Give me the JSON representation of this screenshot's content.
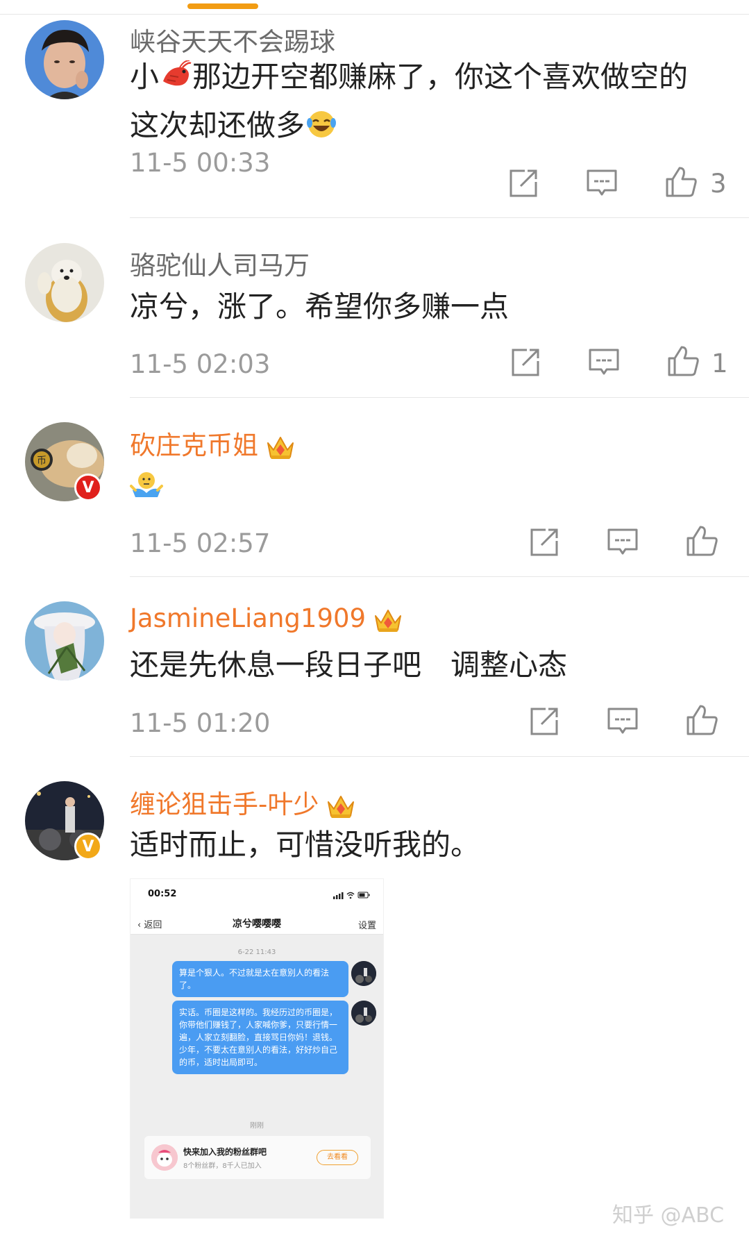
{
  "colors": {
    "accent": "#f29c13",
    "vip_name": "#f0782b",
    "name": "#6b6b6b",
    "meta": "#9b9b9b",
    "bubble": "#4a9cf2"
  },
  "comments": [
    {
      "username": "峡谷天天不会踢球",
      "text_before_emoji": "小",
      "text_after_emoji": "那边开空都赚麻了，你这个喜欢做空的这次却还做多",
      "emojis": [
        "shrimp-emoji",
        "laugh-cry-emoji"
      ],
      "time": "11-5 00:33",
      "likes": "3"
    },
    {
      "username": "骆驼仙人司马万",
      "text": "凉兮，涨了。希望你多赚一点",
      "time": "11-5 02:03",
      "likes": "1"
    },
    {
      "username": "砍庄克币姐",
      "emojis": [
        "shrug-emoji"
      ],
      "time": "11-5 02:57",
      "likes": ""
    },
    {
      "username": "JasmineLiang1909",
      "text": "还是先休息一段日子吧　调整心态",
      "time": "11-5 01:20",
      "likes": ""
    },
    {
      "username": "缠论狙击手-叶少",
      "text": "适时而止，可惜没听我的。"
    }
  ],
  "screenshot": {
    "status_time": "00:52",
    "back": "返回",
    "title": "凉兮嘤嘤嘤",
    "settings": "设置",
    "stamp1": "6-22 11:43",
    "msg1": "算是个狠人。不过就是太在意别人的看法了。",
    "msg2": "实话。币圈是这样的。我经历过的币圈是，你带他们赚钱了，人家喊你爹，只要行情一遍，人家立刻翻脸，直接骂日你妈！退钱。少年，不要太在意别人的看法，好好炒自己的币，适时出局即可。",
    "stamp2": "刚刚",
    "group_title": "快来加入我的粉丝群吧",
    "group_sub": "8个粉丝群，8千人已加入",
    "group_btn": "去看看"
  },
  "watermark": "知乎 @ABC"
}
